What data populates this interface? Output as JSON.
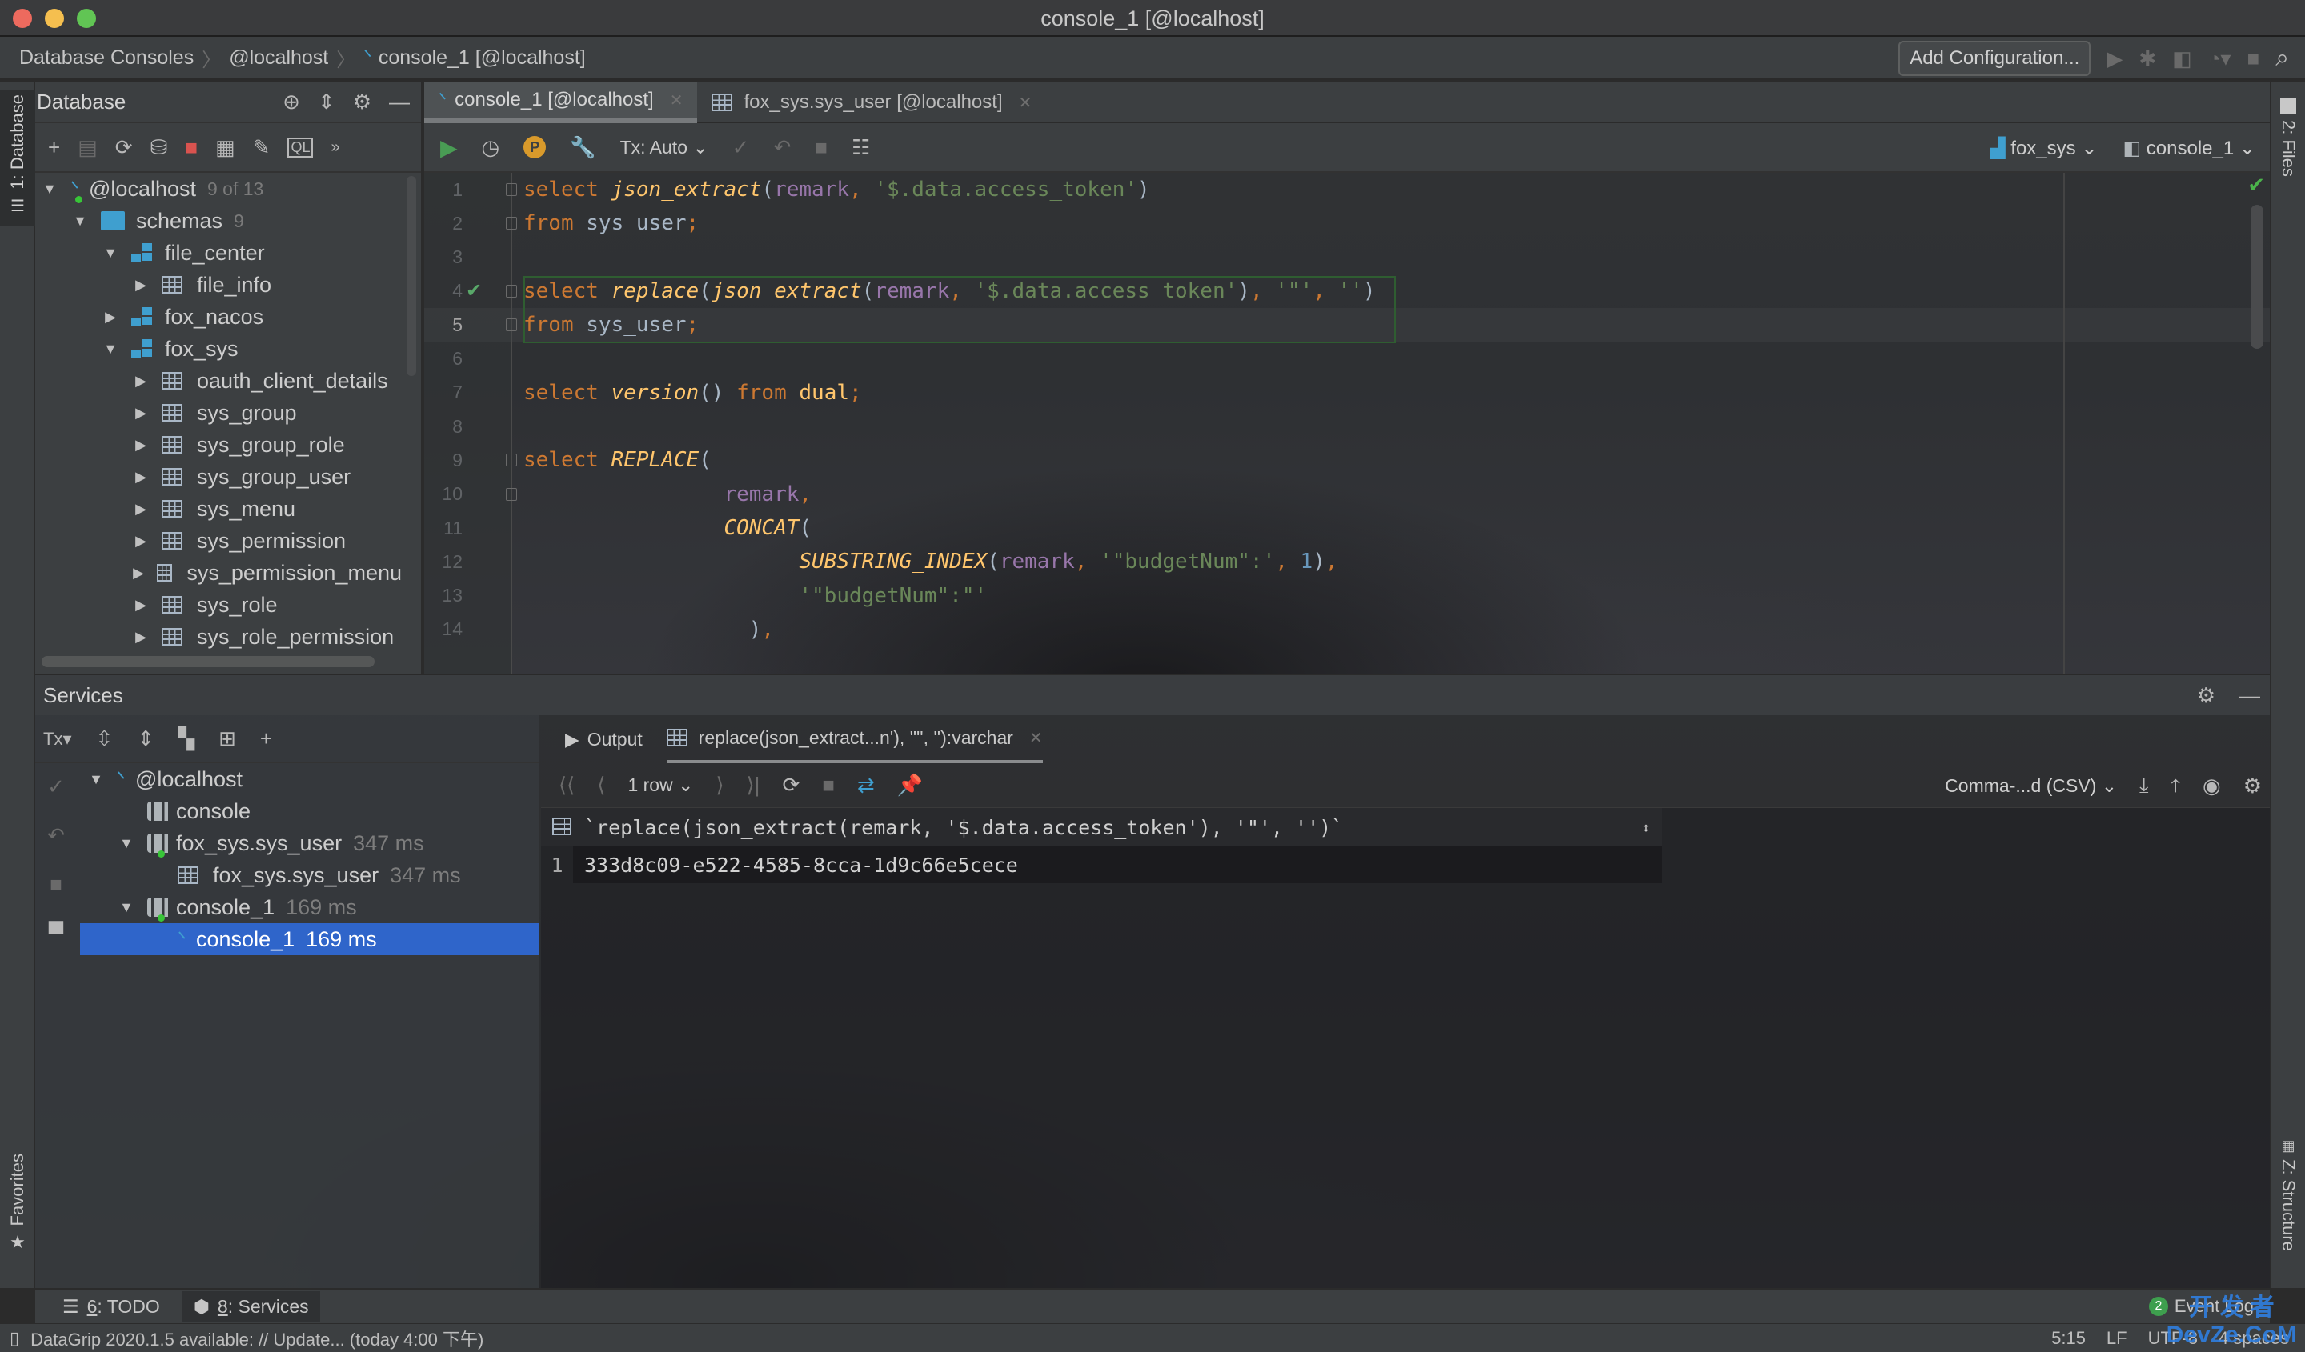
{
  "window": {
    "title": "console_1 [@localhost]"
  },
  "breadcrumb": [
    "Database Consoles",
    "@localhost",
    "console_1 [@localhost]"
  ],
  "nav": {
    "add_configuration": "Add Configuration..."
  },
  "left_stripe": {
    "database_tab": "1: Database",
    "favorites_tab": "Favorites"
  },
  "right_stripe": {
    "files_tab": "2: Files",
    "structure_tab": "Z: Structure"
  },
  "db_panel": {
    "title": "Database",
    "tree": [
      {
        "label": "@localhost",
        "count": "9 of 13",
        "level": 0,
        "expanded": true,
        "icon": "mysql-dolphin-icon"
      },
      {
        "label": "schemas",
        "count": "9",
        "level": 1,
        "expanded": true,
        "icon": "folder-icon"
      },
      {
        "label": "file_center",
        "level": 2,
        "expanded": true,
        "icon": "schema-icon"
      },
      {
        "label": "file_info",
        "level": 3,
        "expanded": false,
        "icon": "table-icon"
      },
      {
        "label": "fox_nacos",
        "level": 2,
        "expanded": false,
        "icon": "schema-icon"
      },
      {
        "label": "fox_sys",
        "level": 2,
        "expanded": true,
        "icon": "schema-icon"
      },
      {
        "label": "oauth_client_details",
        "level": 3,
        "expanded": false,
        "icon": "table-icon"
      },
      {
        "label": "sys_group",
        "level": 3,
        "expanded": false,
        "icon": "table-icon"
      },
      {
        "label": "sys_group_role",
        "level": 3,
        "expanded": false,
        "icon": "table-icon"
      },
      {
        "label": "sys_group_user",
        "level": 3,
        "expanded": false,
        "icon": "table-icon"
      },
      {
        "label": "sys_menu",
        "level": 3,
        "expanded": false,
        "icon": "table-icon"
      },
      {
        "label": "sys_permission",
        "level": 3,
        "expanded": false,
        "icon": "table-icon"
      },
      {
        "label": "sys_permission_menu",
        "level": 3,
        "expanded": false,
        "icon": "table-icon"
      },
      {
        "label": "sys_role",
        "level": 3,
        "expanded": false,
        "icon": "table-icon"
      },
      {
        "label": "sys_role_permission",
        "level": 3,
        "expanded": false,
        "icon": "table-icon"
      }
    ]
  },
  "editor": {
    "tabs": [
      {
        "label": "console_1 [@localhost]",
        "active": true,
        "icon": "console-icon"
      },
      {
        "label": "fox_sys.sys_user [@localhost]",
        "active": false,
        "icon": "table-icon"
      }
    ],
    "toolbar": {
      "tx_mode": "Tx: Auto",
      "schema_selector": "fox_sys",
      "session_selector": "console_1"
    },
    "current_line": 5,
    "lines": [
      [
        {
          "t": "kw",
          "v": "select "
        },
        {
          "t": "fn",
          "v": "json_extract"
        },
        {
          "t": "p",
          "v": "("
        },
        {
          "t": "col",
          "v": "remark"
        },
        {
          "t": "kw",
          "v": ", "
        },
        {
          "t": "str",
          "v": "'$.data.access_token'"
        },
        {
          "t": "p",
          "v": ")"
        }
      ],
      [
        {
          "t": "kw",
          "v": "from "
        },
        {
          "t": "p",
          "v": "sys_user"
        },
        {
          "t": "kw",
          "v": ";"
        }
      ],
      [],
      [
        {
          "t": "kw",
          "v": "select "
        },
        {
          "t": "fn",
          "v": "replace"
        },
        {
          "t": "p",
          "v": "("
        },
        {
          "t": "fn",
          "v": "json_extract"
        },
        {
          "t": "p",
          "v": "("
        },
        {
          "t": "col",
          "v": "remark"
        },
        {
          "t": "kw",
          "v": ", "
        },
        {
          "t": "str",
          "v": "'$.data.access_token'"
        },
        {
          "t": "p",
          "v": ")"
        },
        {
          "t": "kw",
          "v": ", "
        },
        {
          "t": "str",
          "v": "'\"'"
        },
        {
          "t": "kw",
          "v": ", "
        },
        {
          "t": "str",
          "v": "''"
        },
        {
          "t": "p",
          "v": ")"
        }
      ],
      [
        {
          "t": "kw",
          "v": "from "
        },
        {
          "t": "p",
          "v": "sys_user"
        },
        {
          "t": "kw",
          "v": ";"
        }
      ],
      [],
      [
        {
          "t": "kw",
          "v": "select "
        },
        {
          "t": "fn",
          "v": "version"
        },
        {
          "t": "p",
          "v": "() "
        },
        {
          "t": "kw",
          "v": "from "
        },
        {
          "t": "fn2",
          "v": "dual"
        },
        {
          "t": "kw",
          "v": ";"
        }
      ],
      [],
      [
        {
          "t": "kw",
          "v": "select "
        },
        {
          "t": "fn",
          "v": "REPLACE"
        },
        {
          "t": "p",
          "v": "("
        }
      ],
      [
        {
          "t": "p",
          "v": "                "
        },
        {
          "t": "col",
          "v": "remark"
        },
        {
          "t": "kw",
          "v": ","
        }
      ],
      [
        {
          "t": "p",
          "v": "                "
        },
        {
          "t": "fn",
          "v": "CONCAT"
        },
        {
          "t": "p",
          "v": "("
        }
      ],
      [
        {
          "t": "p",
          "v": "                      "
        },
        {
          "t": "fn",
          "v": "SUBSTRING_INDEX"
        },
        {
          "t": "p",
          "v": "("
        },
        {
          "t": "col",
          "v": "remark"
        },
        {
          "t": "kw",
          "v": ", "
        },
        {
          "t": "str",
          "v": "'\"budgetNum\":'"
        },
        {
          "t": "kw",
          "v": ", "
        },
        {
          "t": "num",
          "v": "1"
        },
        {
          "t": "p",
          "v": ")"
        },
        {
          "t": "kw",
          "v": ","
        }
      ],
      [
        {
          "t": "p",
          "v": "                      "
        },
        {
          "t": "str",
          "v": "'\"budgetNum\":\"'"
        }
      ],
      [
        {
          "t": "p",
          "v": "                  "
        },
        {
          "t": "p",
          "v": ")"
        },
        {
          "t": "kw",
          "v": ","
        }
      ]
    ]
  },
  "services": {
    "title": "Services",
    "toolbar": {
      "tx_label": "Tx"
    },
    "tree": [
      {
        "label": "@localhost",
        "time": "",
        "level": 0,
        "expanded": true,
        "icon": "mysql-dolphin-icon",
        "selected": false
      },
      {
        "label": "console",
        "time": "",
        "level": 1,
        "icon": "console-icon",
        "selected": false
      },
      {
        "label": "fox_sys.sys_user",
        "time": "347 ms",
        "level": 1,
        "expanded": true,
        "icon": "console-icon",
        "selected": false
      },
      {
        "label": "fox_sys.sys_user",
        "time": "347 ms",
        "level": 2,
        "icon": "table-icon",
        "selected": false
      },
      {
        "label": "console_1",
        "time": "169 ms",
        "level": 1,
        "expanded": true,
        "icon": "console-icon",
        "selected": false
      },
      {
        "label": "console_1",
        "time": "169 ms",
        "level": 2,
        "icon": "mysql-dolphin-icon",
        "selected": true
      }
    ],
    "output_tabs": [
      {
        "label": "Output",
        "active": false
      },
      {
        "label": "replace(json_extract...n'), '\"', ''):varchar",
        "active": true
      }
    ],
    "grid_toolbar": {
      "rows": "1 row",
      "export_format": "Comma-...d (CSV)"
    },
    "grid": {
      "column_header": "`replace(json_extract(remark, '$.data.access_token'), '\"', '')`",
      "rows": [
        {
          "num": "1",
          "value": "333d8c09-e522-4585-8cca-1d9c66e5cece"
        }
      ]
    }
  },
  "tool_tabs": [
    {
      "num": "6",
      "label": ": TODO",
      "active": false
    },
    {
      "num": "8",
      "label": ": Services",
      "active": true
    }
  ],
  "event_log": {
    "count": "2",
    "label": "Event Log"
  },
  "status": {
    "message": "DataGrip 2020.1.5 available: // Update... (today 4:00 下午)",
    "position": "5:15",
    "line_sep": "LF",
    "encoding": "UTF-8",
    "indent": "4 spaces"
  },
  "watermark": {
    "line1": "开 发 者",
    "line2": "DevZe.CoM"
  },
  "colors": {
    "keyword": "#cc7832",
    "function": "#ffc66d",
    "column": "#9876aa",
    "string": "#6a8759",
    "number": "#6897bb",
    "selection": "#2f65ca",
    "success": "#59a869"
  }
}
